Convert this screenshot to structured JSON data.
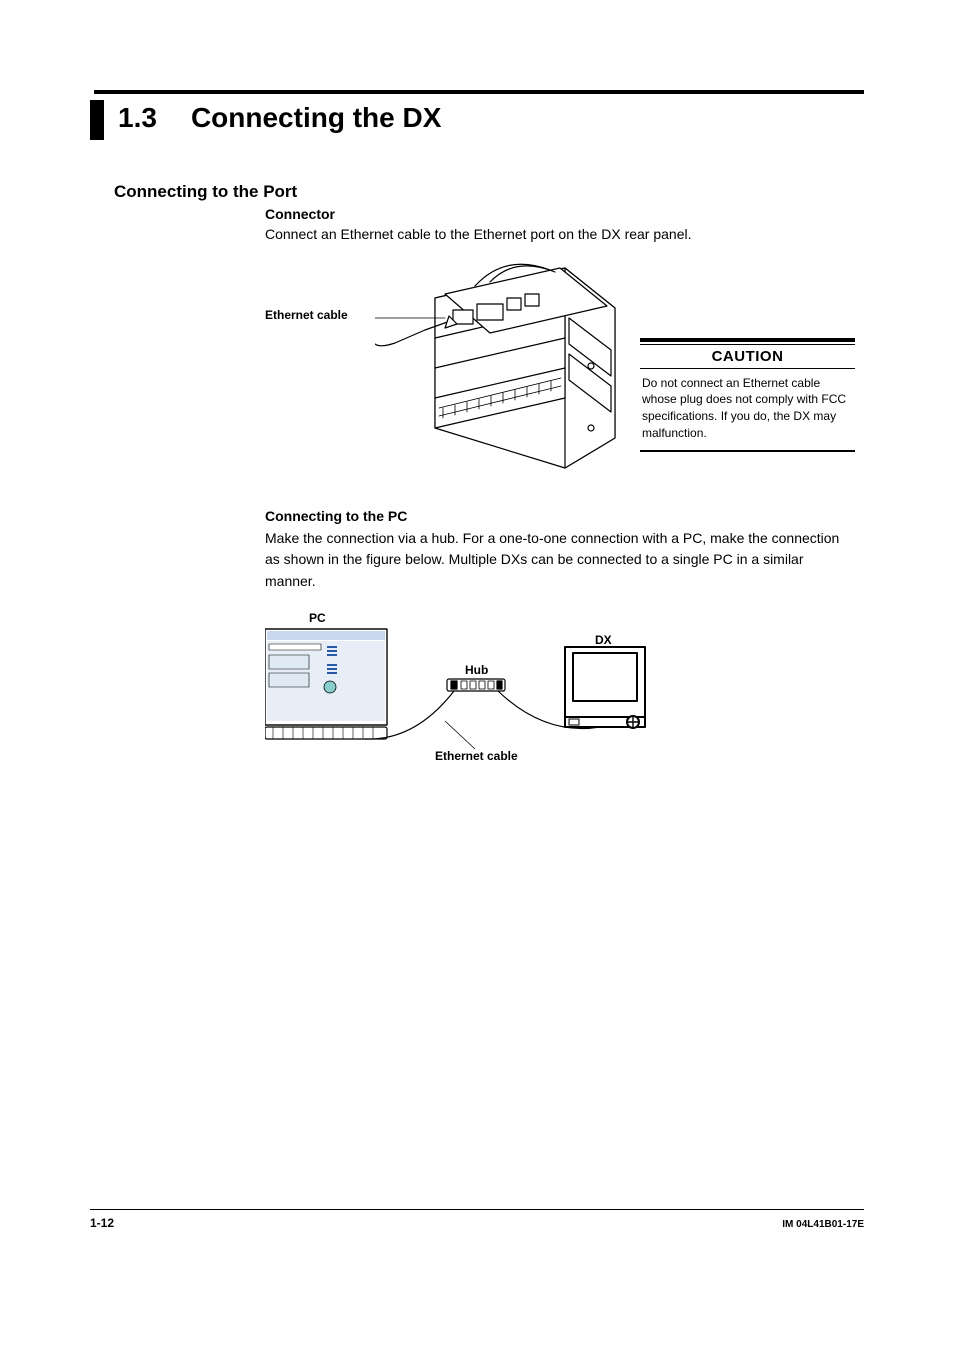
{
  "section": {
    "number": "1.3",
    "title": "Connecting the DX"
  },
  "h2_connecting_port": "Connecting to the Port",
  "h3_connector": "Connector",
  "p_connector": "Connect an Ethernet cable to the Ethernet port on the DX rear panel.",
  "labels": {
    "ethernet_cable": "Ethernet cable",
    "pc": "PC",
    "hub": "Hub",
    "dx": "DX",
    "ethernet_cable2": "Ethernet cable"
  },
  "caution": {
    "title": "CAUTION",
    "body": "Do not connect an Ethernet cable whose plug does not comply with FCC specifications. If you do, the DX may malfunction."
  },
  "h3_connecting_pc": "Connecting to the PC",
  "p_connecting_pc": "Make the connection via a hub.  For a one-to-one connection with a PC, make the connection as shown in the figure below.  Multiple DXs can be connected to a single PC in a similar manner.",
  "footer": {
    "page": "1-12",
    "doc_id": "IM 04L41B01-17E"
  }
}
